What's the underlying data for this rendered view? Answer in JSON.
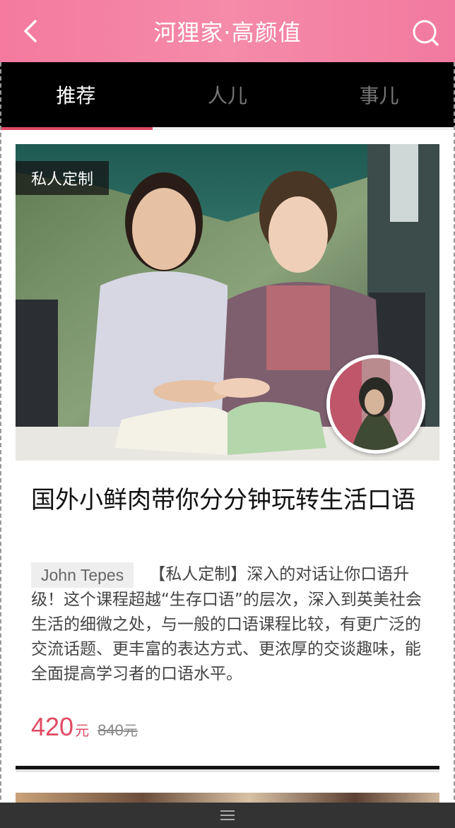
{
  "header": {
    "title": "河狸家·高颜值",
    "back_icon": "chevron-left-icon",
    "search_icon": "search-icon",
    "background": "#f47aa0"
  },
  "tabs": [
    {
      "label": "推荐",
      "active": true
    },
    {
      "label": "人儿",
      "active": false
    },
    {
      "label": "事儿",
      "active": false
    }
  ],
  "accent_color": "#e04a63",
  "card": {
    "badge": "私人定制",
    "title": "国外小鲜肉带你分分钟玩转生活口语",
    "author": "John Tepes",
    "description": "【私人定制】深入的对话让你口语升级！这个课程超越“生存口语”的层次，深入到英美社会生活的细微之处，与一般的口语课程比较，有更广泛的交流话题、更丰富的表达方式、更浓厚的交谈趣味，能全面提高学习者的口语水平。",
    "price": "420",
    "price_unit": "元",
    "old_price": "840",
    "old_price_unit": "元"
  },
  "bottom_bar": {
    "icon": "menu-icon"
  }
}
